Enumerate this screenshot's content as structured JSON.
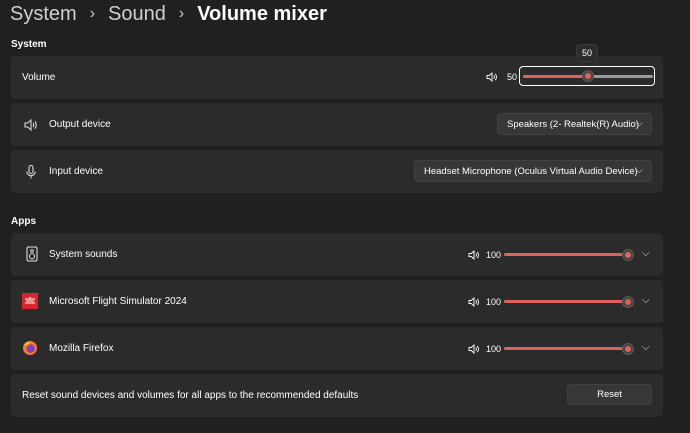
{
  "breadcrumb": {
    "items": [
      "System",
      "Sound",
      "Volume mixer"
    ]
  },
  "system": {
    "section_label": "System",
    "volume": {
      "label": "Volume",
      "value_text": "50",
      "tooltip": "50",
      "level": 0.5
    },
    "output": {
      "label": "Output device",
      "selected": "Speakers (2- Realtek(R) Audio)"
    },
    "input": {
      "label": "Input device",
      "selected": "Headset Microphone (Oculus Virtual Audio Device)"
    }
  },
  "apps": {
    "section_label": "Apps",
    "items": [
      {
        "name": "System sounds",
        "volume_text": "100",
        "level": 1.0,
        "icon": "speaker-box-icon"
      },
      {
        "name": "Microsoft Flight Simulator 2024",
        "volume_text": "100",
        "level": 1.0,
        "icon": "flight-simulator-icon"
      },
      {
        "name": "Mozilla Firefox",
        "volume_text": "100",
        "level": 1.0,
        "icon": "firefox-icon"
      }
    ]
  },
  "reset": {
    "text": "Reset sound devices and volumes for all apps to the recommended defaults",
    "button_label": "Reset"
  },
  "colors": {
    "accent": "#e0605a",
    "background": "#202020",
    "card": "#2b2b2b"
  }
}
